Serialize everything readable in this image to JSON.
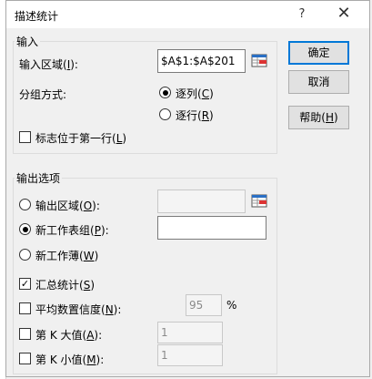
{
  "window": {
    "title": "描述统计",
    "help_glyph": "?",
    "close_glyph": "✕"
  },
  "input_group": {
    "legend": "输入",
    "range_label": {
      "text": "输入区域(",
      "key": "I",
      "suffix": "):"
    },
    "range_value": "$A$1:$A$201",
    "grouping_label": "分组方式:",
    "by_column": {
      "text": "逐列(",
      "key": "C",
      "suffix": ")",
      "checked": true
    },
    "by_row": {
      "text": "逐行(",
      "key": "R",
      "suffix": ")",
      "checked": false
    },
    "labels_first_row": {
      "text": "标志位于第一行(",
      "key": "L",
      "suffix": ")",
      "checked": false
    }
  },
  "buttons": {
    "ok": "确定",
    "cancel": "取消",
    "help": {
      "text": "帮助(",
      "key": "H",
      "suffix": ")"
    }
  },
  "output_group": {
    "legend": "输出选项",
    "output_range": {
      "text": "输出区域(",
      "key": "O",
      "suffix": "):",
      "checked": false,
      "value": ""
    },
    "new_sheet": {
      "text": "新工作表组(",
      "key": "P",
      "suffix": "):",
      "checked": true,
      "value": ""
    },
    "new_workbook": {
      "text": "新工作薄(",
      "key": "W",
      "suffix": ")",
      "checked": false
    },
    "summary_stats": {
      "text": "汇总统计(",
      "key": "S",
      "suffix": ")",
      "checked": true
    },
    "confidence": {
      "text": "平均数置信度(",
      "key": "N",
      "suffix": "):",
      "checked": false,
      "value": "95",
      "unit": "%"
    },
    "kth_largest": {
      "text": "第 K 大值(",
      "key": "A",
      "suffix": "):",
      "checked": false,
      "value": "1"
    },
    "kth_smallest": {
      "text": "第 K 小值(",
      "key": "M",
      "suffix": "):",
      "checked": false,
      "value": "1"
    }
  },
  "icons": {
    "ref_icon": "range-select-icon",
    "accent": "#0078d7"
  }
}
